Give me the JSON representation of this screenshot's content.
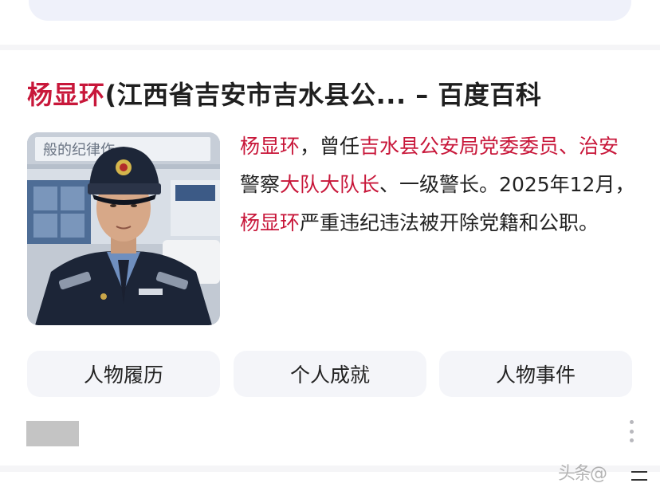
{
  "result": {
    "title_highlight": "杨显环",
    "title_rest": "(江西省吉安市吉水县公... – 百度百科",
    "abstract": {
      "seg1": "杨显环",
      "seg2": "，曾任",
      "seg3": "吉水县公安局党委委员、治安",
      "seg4": "警察",
      "seg5": "大队大队长",
      "seg6": "、一级警长。2025年12月，",
      "seg7": "杨显环",
      "seg8": "严重违纪违法被开除党籍和公职。"
    },
    "tabs": [
      "人物履历",
      "个人成就",
      "人物事件"
    ],
    "photo_sign_text": "般的纪律作"
  },
  "watermark": "头条@",
  "colors": {
    "highlight": "#c8173a",
    "tab_bg": "#f4f5f9",
    "separator": "#f5f5f7"
  }
}
